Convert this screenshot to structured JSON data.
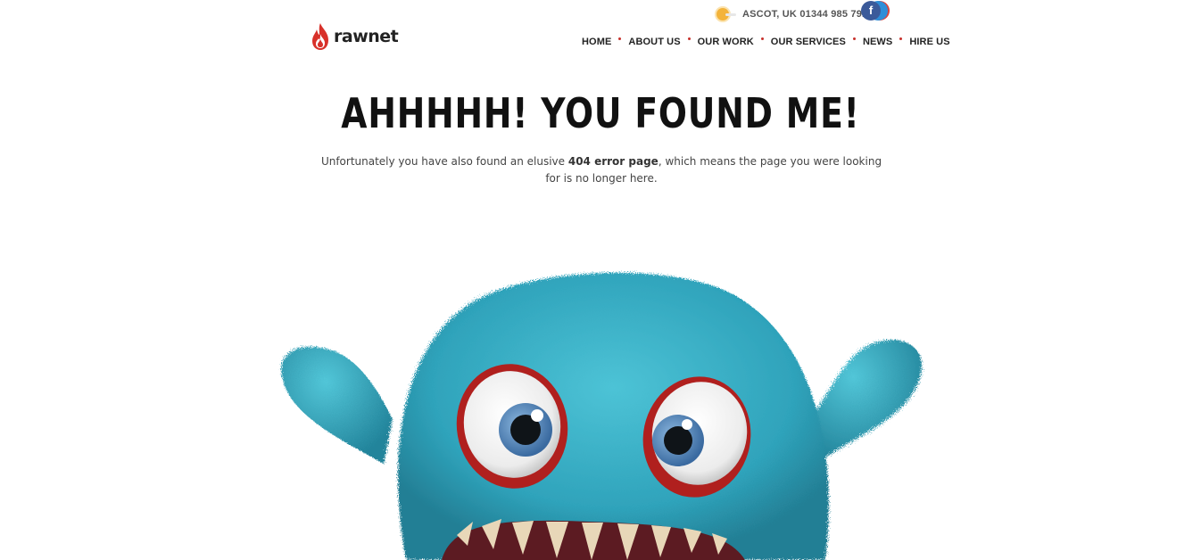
{
  "brand": {
    "name": "rawnet",
    "flame_color": "#d8312a"
  },
  "header": {
    "location": "ASCOT, UK",
    "phone": "01344 985 791",
    "social": [
      {
        "name": "facebook",
        "label": "f",
        "color": "#3b5a9a"
      },
      {
        "name": "twitter",
        "color": "#2e8ed8"
      }
    ]
  },
  "nav": {
    "items": [
      {
        "label": "HOME"
      },
      {
        "label": "ABOUT US"
      },
      {
        "label": "OUR WORK"
      },
      {
        "label": "OUR SERVICES"
      },
      {
        "label": "NEWS"
      },
      {
        "label": "HIRE US"
      }
    ],
    "separator_color": "#c7302a"
  },
  "main": {
    "headline": "AHHHHH! YOU FOUND ME!",
    "message_before": "Unfortunately you have also found an elusive ",
    "message_bold": "404 error page",
    "message_after": ", which means the page you were looking for is no longer here."
  },
  "illustration": {
    "subject": "blue-fuzzy-monster",
    "fur_color": "#34aac0",
    "eye_rim_color": "#b0201e"
  }
}
